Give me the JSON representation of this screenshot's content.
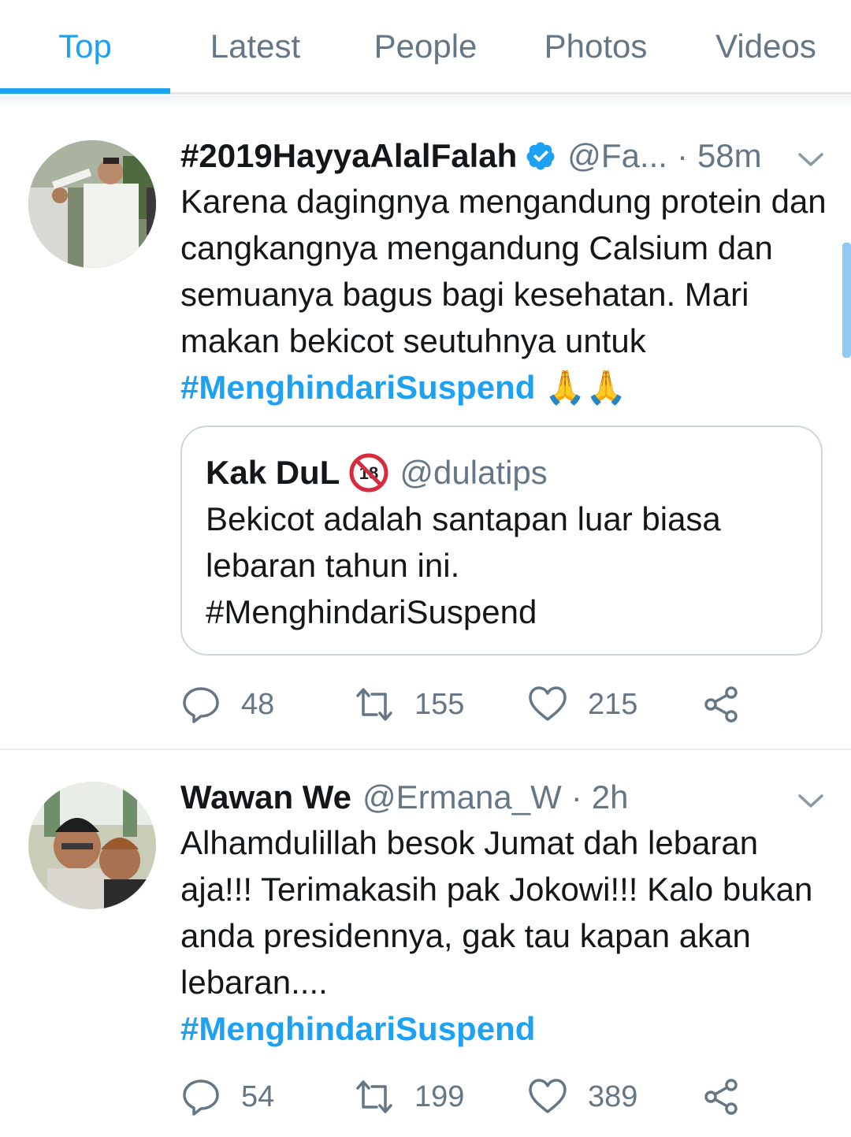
{
  "tabs": [
    {
      "label": "Top"
    },
    {
      "label": "Latest"
    },
    {
      "label": "People"
    },
    {
      "label": "Photos"
    },
    {
      "label": "Videos"
    }
  ],
  "colors": {
    "accent": "#1da1f2",
    "muted": "#657786",
    "text": "#14171a",
    "border": "#e6ecf0"
  },
  "tweets": [
    {
      "display_name": "#2019HayyaAlalFalah",
      "verified": true,
      "handle": "@Fa...",
      "separator": "·",
      "time": "58m",
      "text": "Karena dagingnya mengandung protein dan cangkangnya mengandung Calsium dan semuanya bagus bagi kesehatan. Mari makan bekicot seutuhnya  untuk",
      "hashtag": "#MenghindariSuspend",
      "emoji": "🙏🙏",
      "quote": {
        "display_name": "Kak DuL",
        "badge": "18",
        "handle": "@dulatips",
        "text_line1": "Bekicot adalah santapan luar biasa lebaran tahun ini.",
        "text_line2": "#MenghindariSuspend"
      },
      "replies": "48",
      "retweets": "155",
      "likes": "215"
    },
    {
      "display_name": "Wawan We",
      "handle": "@Ermana_W",
      "separator": "·",
      "time": "2h",
      "text": "Alhamdulillah besok Jumat dah lebaran aja!!! Terimakasih pak Jokowi!!! Kalo bukan anda presidennya, gak tau kapan akan lebaran....",
      "hashtag": "#MenghindariSuspend",
      "replies": "54",
      "retweets": "199",
      "likes": "389"
    }
  ]
}
